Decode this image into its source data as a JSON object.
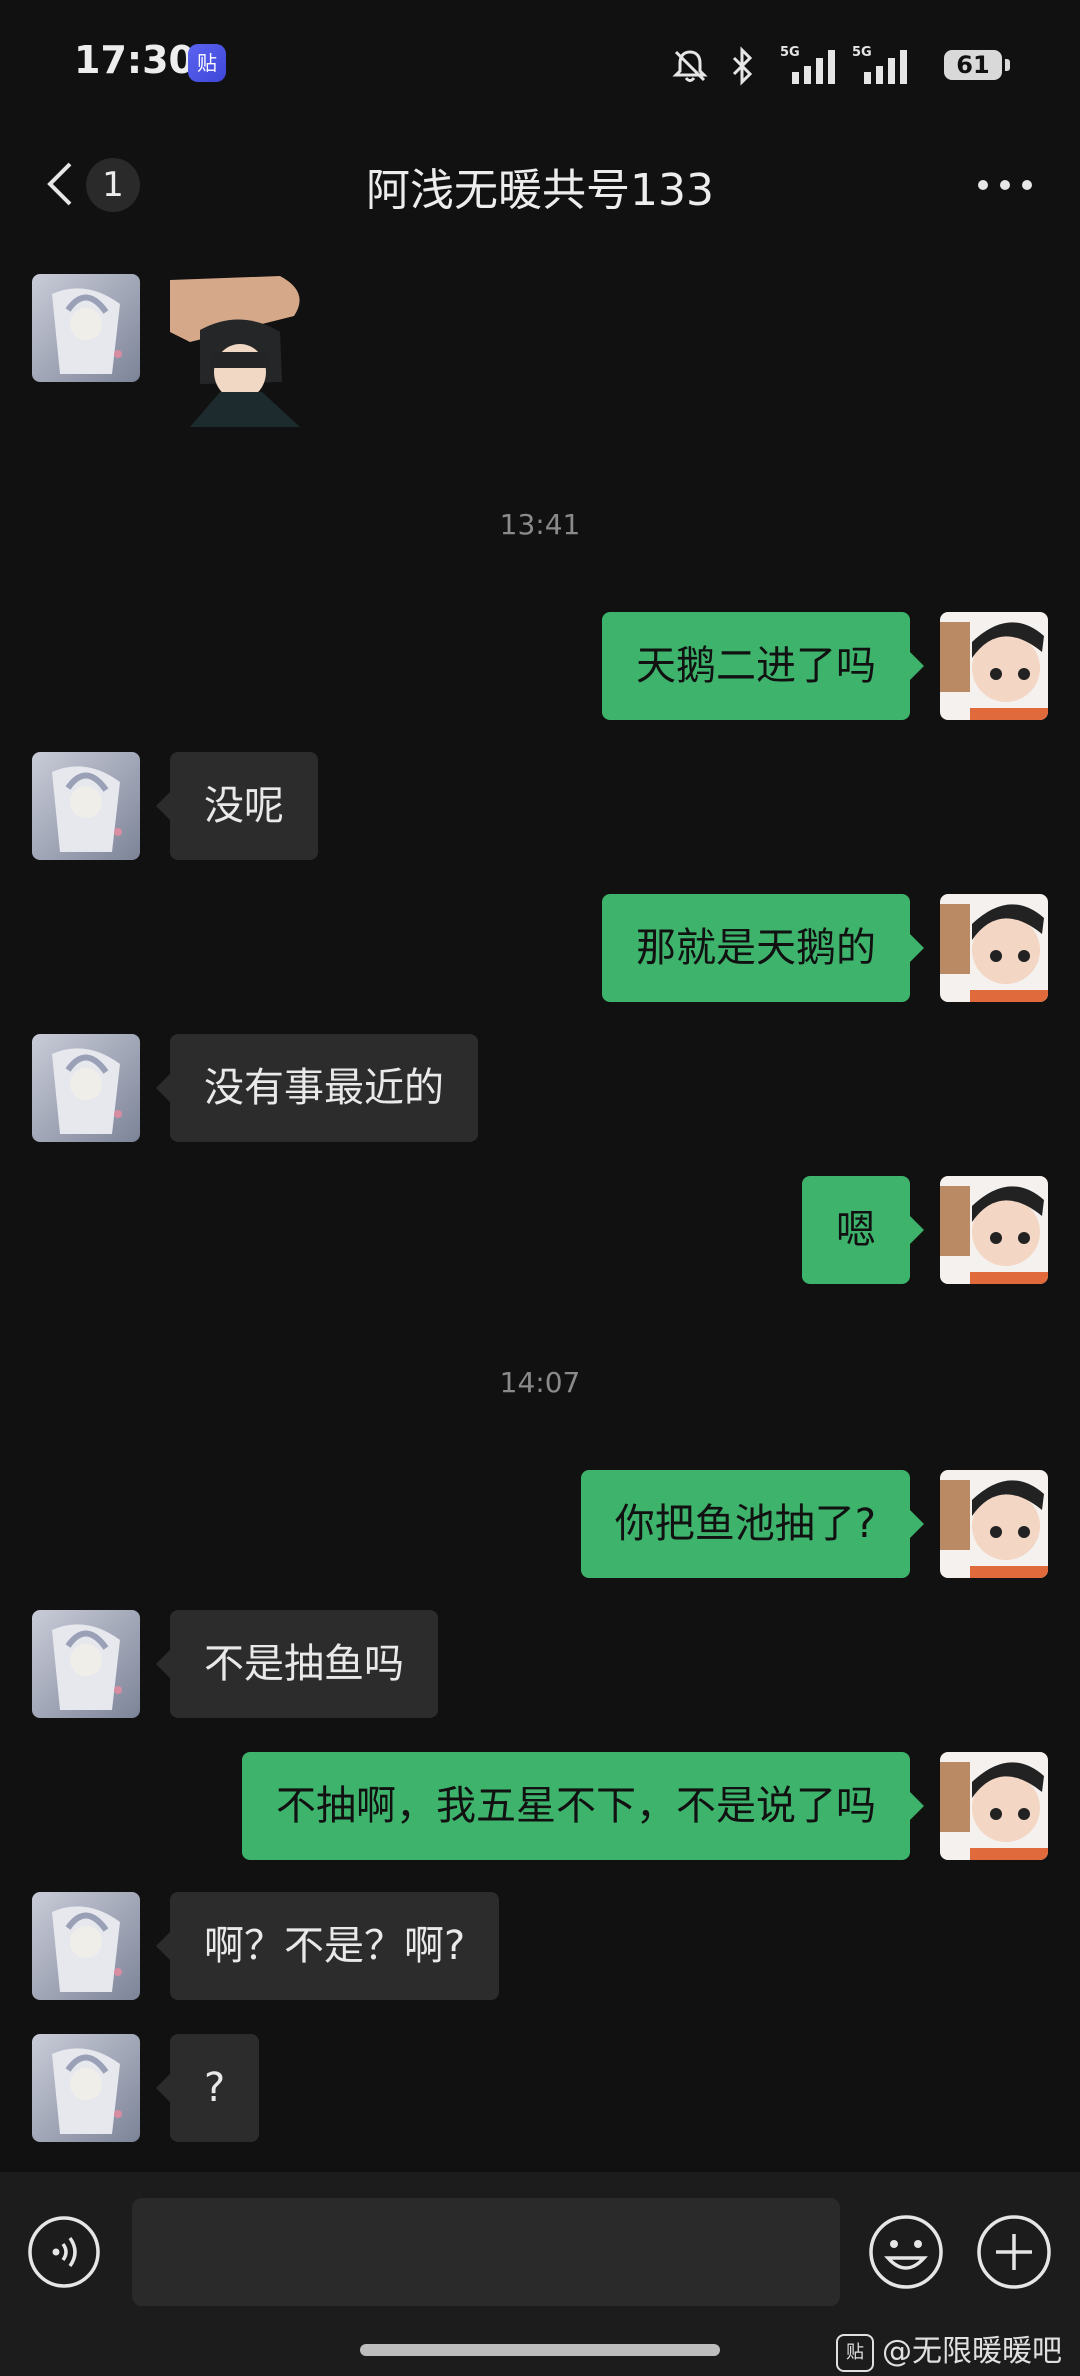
{
  "status_bar": {
    "time": "17:30",
    "app_badge": "贴",
    "battery": "61",
    "network_labels": [
      "5G",
      "5G"
    ]
  },
  "header": {
    "unread_count": "1",
    "title": "阿浅无暖共号133"
  },
  "messages": {
    "ts1": "13:41",
    "ts2": "14:07",
    "m1": "天鹅二进了吗",
    "m2": "没呢",
    "m3": "那就是天鹅的",
    "m4": "没有事最近的",
    "m5": "嗯",
    "m6": "你把鱼池抽了?",
    "m7": "不是抽鱼吗",
    "m8": "不抽啊，我五星不下，不是说了吗",
    "m9": "啊？不是？啊?",
    "m10": "?"
  },
  "watermark": {
    "icon": "贴",
    "text": "@无限暖暖吧"
  },
  "colors": {
    "background": "#111111",
    "outgoing_bubble": "#3db36c",
    "incoming_bubble": "#2c2c2c"
  },
  "icons": [
    "back-icon",
    "more-icon",
    "voice-icon",
    "emoji-icon",
    "plus-icon",
    "mute-icon",
    "bluetooth-icon",
    "signal-icon"
  ]
}
